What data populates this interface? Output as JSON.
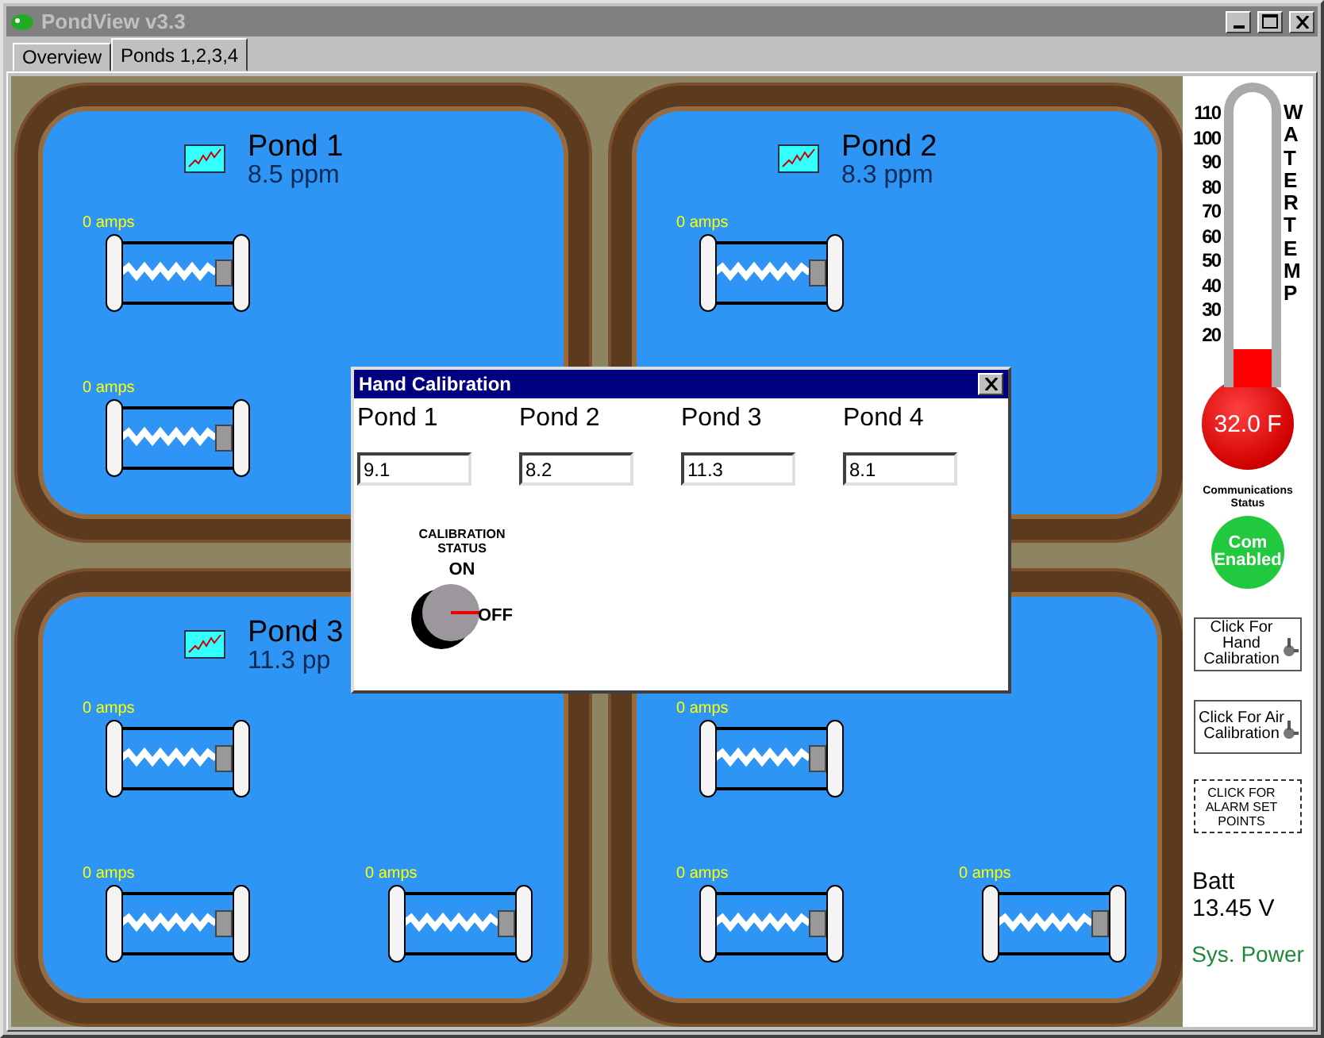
{
  "window": {
    "title": "PondView v3.3"
  },
  "tabs": [
    {
      "label": "Overview",
      "selected": false
    },
    {
      "label": "Ponds 1,2,3,4",
      "selected": true
    }
  ],
  "ponds": [
    {
      "title": "Pond 1",
      "reading": "8.5 ppm",
      "rows": [
        [
          {
            "amps": "0 amps"
          }
        ],
        [
          {
            "amps": "0 amps"
          }
        ]
      ]
    },
    {
      "title": "Pond 2",
      "reading": "8.3 ppm",
      "rows": [
        [
          {
            "amps": "0 amps"
          }
        ],
        [
          {}
        ]
      ]
    },
    {
      "title": "Pond 3",
      "reading": "11.3 pp",
      "rows": [
        [
          {
            "amps": "0 amps"
          }
        ],
        [
          {
            "amps": "0 amps"
          },
          {
            "amps": "0 amps"
          }
        ]
      ]
    },
    {
      "rows": [
        [
          {
            "amps": "0 amps"
          }
        ],
        [
          {
            "amps": "0 amps"
          },
          {
            "amps": "0 amps"
          }
        ]
      ]
    }
  ],
  "thermometer": {
    "scale": [
      "110",
      "100",
      "90",
      "80",
      "70",
      "60",
      "50",
      "40",
      "30",
      "20"
    ],
    "label": "WATER TEMP",
    "level": 0.13,
    "reading": "32.0 F"
  },
  "communications": {
    "label": "Communications Status",
    "status": "Com Enabled",
    "on": true
  },
  "buttons": [
    {
      "kind": "calibration",
      "label": "Click For Hand Calibration"
    },
    {
      "kind": "calibration",
      "label": "Click For Air Calibration"
    },
    {
      "kind": "alarm",
      "label": "CLICK FOR ALARM SET POINTS"
    }
  ],
  "battery": {
    "label": "Batt",
    "reading": "13.45 V",
    "power": "Sys. Power"
  },
  "dialog": {
    "title": "Hand Calibration",
    "fields": [
      {
        "label": "Pond 1",
        "value": "9.1"
      },
      {
        "label": "Pond 2",
        "value": "8.2"
      },
      {
        "label": "Pond 3",
        "value": "11.3"
      },
      {
        "label": "Pond 4",
        "value": "8.1"
      }
    ],
    "calibration": {
      "label": "CALIBRATION STATUS",
      "on_label": "ON",
      "off_label": "OFF",
      "on": false
    }
  }
}
